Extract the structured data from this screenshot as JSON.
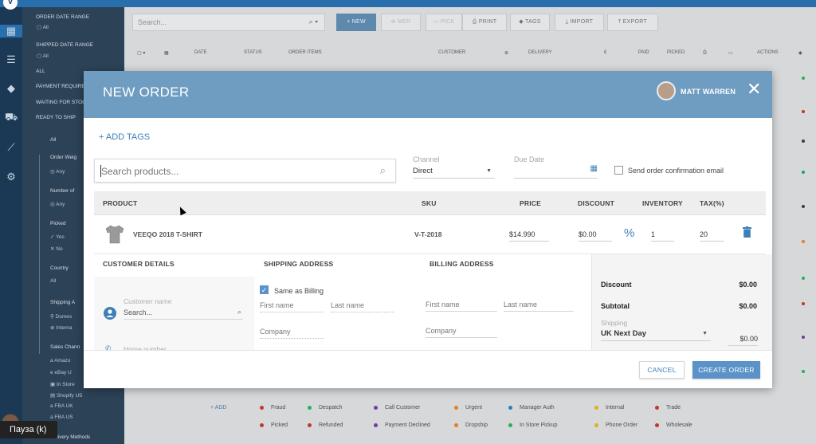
{
  "topbar": {
    "right_items": [
      "",
      "",
      "",
      ""
    ]
  },
  "filters": {
    "order_date_range_label": "ORDER DATE RANGE",
    "order_date_range_value": "All",
    "shipped_date_range_label": "SHIPPED DATE RANGE",
    "shipped_date_range_value": "All",
    "status_items": [
      "ALL",
      "PAYMENT REQUIRED",
      "WAITING FOR STOCK",
      "READY TO SHIP"
    ],
    "all_label": "All",
    "order_weight_label": "Order Weig",
    "order_weight_value": "Any",
    "number_of_label": "Number of",
    "number_of_value": "Any",
    "picked_label": "Picked",
    "picked_yes": "Yes",
    "picked_no": "No",
    "country_label": "Country",
    "country_value": "All",
    "shipping_label": "Shipping A",
    "shipping_domestic": "Domes",
    "shipping_international": "Interna",
    "sales_channel_label": "Sales Chann",
    "sales_channels": [
      "Amazo",
      "eBay U",
      "In Store",
      "Shopify US",
      "FBA UK",
      "FBA US"
    ],
    "delivery_methods_label": "Delivery Methods"
  },
  "main": {
    "search_placeholder": "Search...",
    "toolbar": {
      "new": "NEW",
      "merge": "MER",
      "pick": "PICK",
      "print": "PRINT",
      "tags": "TAGS",
      "import": "IMPORT",
      "export": "EXPORT"
    },
    "columns": [
      "DATE",
      "STATUS",
      "ORDER ITEMS",
      "CUSTOMER",
      "DELIVERY",
      "£",
      "PAID",
      "PICKED",
      "ACTIONS"
    ],
    "legend_add": "ADD",
    "legend": [
      {
        "label": "Fraud",
        "color": "#c0392b"
      },
      {
        "label": "Despatch",
        "color": "#27ae60"
      },
      {
        "label": "Call Customer",
        "color": "#6c3fa0"
      },
      {
        "label": "Urgent",
        "color": "#e67e22"
      },
      {
        "label": "Manager Auth",
        "color": "#2980b9"
      },
      {
        "label": "Internal",
        "color": "#e0b020"
      },
      {
        "label": "Trade",
        "color": "#c0392b"
      },
      {
        "label": "Picked",
        "color": "#c0392b"
      },
      {
        "label": "Refunded",
        "color": "#c0392b"
      },
      {
        "label": "Payment Declined",
        "color": "#6c3fa0"
      },
      {
        "label": "Dropship",
        "color": "#e67e22"
      },
      {
        "label": "In Store Pickup",
        "color": "#27ae60"
      },
      {
        "label": "Phone Order",
        "color": "#e0b020"
      },
      {
        "label": "Wholesale",
        "color": "#c0392b"
      }
    ]
  },
  "pause_label": "Пауза (k)",
  "modal": {
    "title": "NEW ORDER",
    "user": "MATT WARREN",
    "add_tags": "+ ADD TAGS",
    "product_search_placeholder": "Search products...",
    "channel_label": "Channel",
    "channel_value": "Direct",
    "due_date_label": "Due Date",
    "send_confirmation_label": "Send order confirmation email",
    "product_table": {
      "headers": [
        "PRODUCT",
        "SKU",
        "PRICE",
        "DISCOUNT",
        "INVENTORY",
        "TAX(%)"
      ],
      "row": {
        "name": "VEEQO 2018 T-SHIRT",
        "sku": "V-T-2018",
        "price": "$14.990",
        "discount": "$0.00",
        "inventory": "1",
        "tax": "20"
      }
    },
    "sections": {
      "customer": "CUSTOMER DETAILS",
      "shipping": "SHIPPING ADDRESS",
      "billing": "BILLING ADDRESS"
    },
    "customer": {
      "name_label": "Customer name",
      "search_placeholder": "Search...",
      "phone_placeholder": "Home number"
    },
    "shipping": {
      "same_as_billing": "Same as Billing",
      "first_name": "First name",
      "last_name": "Last name",
      "company": "Company"
    },
    "billing": {
      "first_name": "First name",
      "last_name": "Last name",
      "company": "Company"
    },
    "summary": {
      "discount_label": "Discount",
      "discount_value": "$0.00",
      "subtotal_label": "Subtotal",
      "subtotal_value": "$0.00",
      "shipping_label": "Shipping",
      "shipping_method": "UK Next Day",
      "shipping_value": "$0.00"
    },
    "cancel": "CANCEL",
    "create": "CREATE ORDER"
  }
}
